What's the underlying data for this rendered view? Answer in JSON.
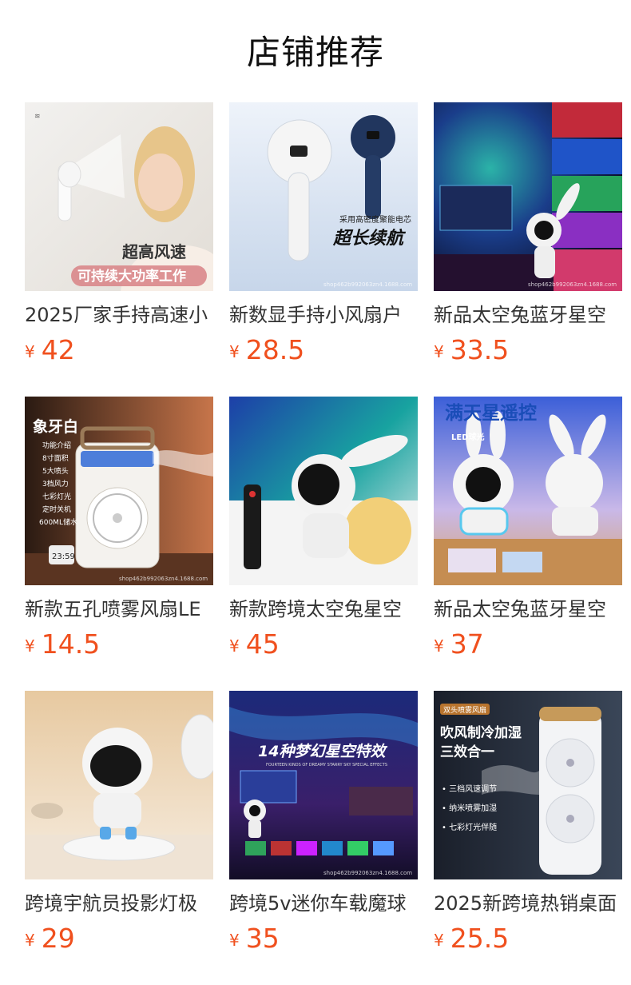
{
  "section": {
    "title": "店铺推荐"
  },
  "products": [
    {
      "name": "2025厂家手持高速小",
      "currency": "¥",
      "price": "42",
      "image_text": [
        "超高风速",
        "可持续大功率工作"
      ]
    },
    {
      "name": "新数显手持小风扇户",
      "currency": "¥",
      "price": "28.5",
      "image_text": [
        "采用高密度聚能电芯",
        "超长续航",
        "shop462b992063zn4.1688.com"
      ]
    },
    {
      "name": "新品太空兔蓝牙星空",
      "currency": "¥",
      "price": "33.5",
      "image_text": [
        "shop462b992063zn4.1688.com"
      ]
    },
    {
      "name": "新款五孔喷雾风扇LE",
      "currency": "¥",
      "price": "14.5",
      "image_text": [
        "象牙白",
        "功能介绍",
        "8寸面积",
        "5大喷头",
        "3档风力",
        "七彩灯光",
        "定时关机",
        "600ML储水",
        "23:59",
        "shop462b992063zn4.1688.com"
      ]
    },
    {
      "name": "新款跨境太空兔星空",
      "currency": "¥",
      "price": "45",
      "image_text": []
    },
    {
      "name": "新品太空兔蓝牙星空",
      "currency": "¥",
      "price": "37",
      "image_text": [
        "满天星遥控",
        "LED球光"
      ]
    },
    {
      "name": "跨境宇航员投影灯极",
      "currency": "¥",
      "price": "29",
      "image_text": []
    },
    {
      "name": "跨境5v迷你车载魔球",
      "currency": "¥",
      "price": "35",
      "image_text": [
        "14种梦幻星空特效",
        "FOURTEEN KINDS OF DREAMY STARRY SKY SPECIAL EFFECTS",
        "shop462b992063zn4.1688.com"
      ]
    },
    {
      "name": "2025新跨境热销桌面",
      "currency": "¥",
      "price": "25.5",
      "image_text": [
        "双头喷雾风扇",
        "吹风制冷加湿",
        "三效合一",
        "• 三档风速调节",
        "• 纳米喷雾加湿",
        "• 七彩灯光伴随"
      ]
    }
  ]
}
